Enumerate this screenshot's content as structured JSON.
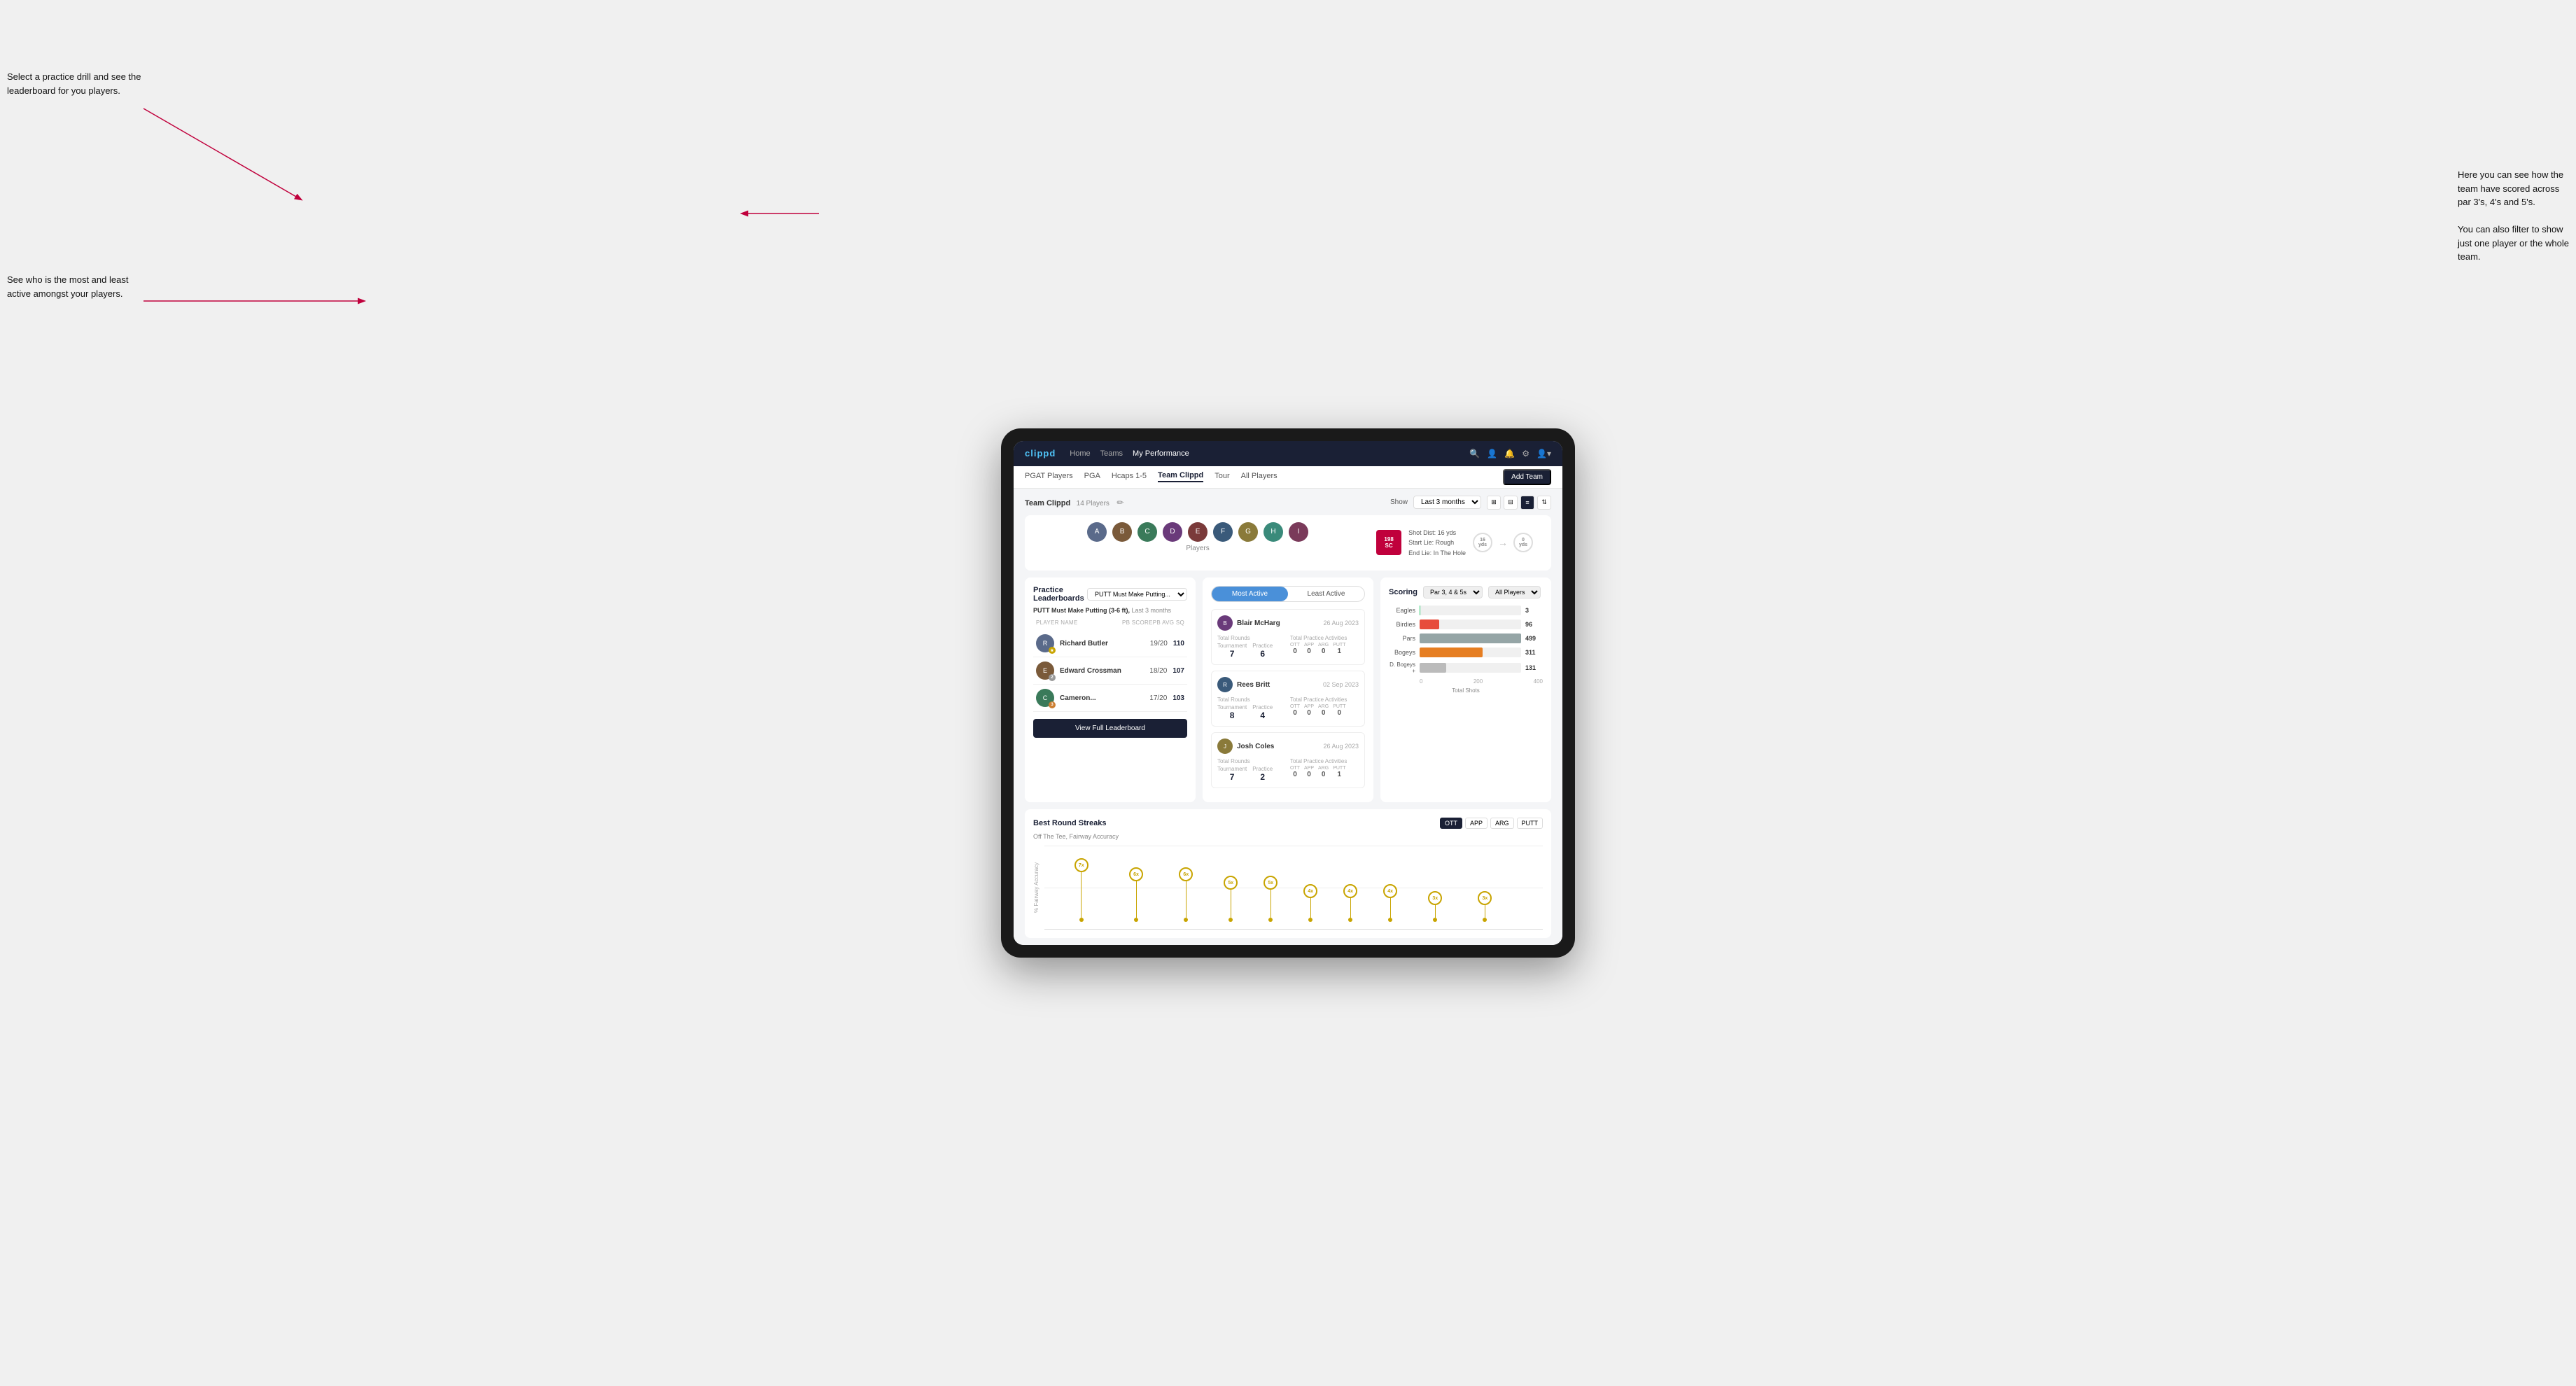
{
  "app": {
    "logo": "clippd",
    "nav": {
      "links": [
        "Home",
        "Teams",
        "My Performance"
      ],
      "icons": [
        "search",
        "person",
        "bell",
        "settings",
        "avatar"
      ]
    },
    "subnav": {
      "links": [
        "PGAT Players",
        "PGA",
        "Hcaps 1-5",
        "Team Clippd",
        "Tour",
        "All Players"
      ],
      "active": "Team Clippd",
      "add_team_label": "Add Team"
    }
  },
  "team": {
    "title": "Team Clippd",
    "player_count": "14 Players",
    "show_label": "Show",
    "show_value": "Last 3 months",
    "view_options": [
      "grid-small",
      "grid-large",
      "list-detail",
      "filter"
    ]
  },
  "players": {
    "label": "Players",
    "count": 9
  },
  "shot_panel": {
    "badge_number": "198",
    "badge_unit": "SC",
    "info_lines": [
      "Shot Dist: 16 yds",
      "Start Lie: Rough",
      "End Lie: In The Hole"
    ],
    "circle_left": {
      "value": "16",
      "unit": "yds"
    },
    "circle_right": {
      "value": "0",
      "unit": "yds"
    }
  },
  "leaderboard": {
    "title": "Practice Leaderboards",
    "drill_label": "PUTT Must Make Putting...",
    "subtitle": "PUTT Must Make Putting (3-6 ft),",
    "period": "Last 3 months",
    "col_player": "PLAYER NAME",
    "col_score": "PB SCORE",
    "col_avg": "PB AVG SQ",
    "players": [
      {
        "name": "Richard Butler",
        "score": "19/20",
        "avg": "110",
        "badge": "gold",
        "badge_num": "1",
        "avatar_color": "#5a6a8a"
      },
      {
        "name": "Edward Crossman",
        "score": "18/20",
        "avg": "107",
        "badge": "silver",
        "badge_num": "2",
        "avatar_color": "#7a5a3a"
      },
      {
        "name": "Cameron...",
        "score": "17/20",
        "avg": "103",
        "badge": "bronze",
        "badge_num": "3",
        "avatar_color": "#3a7a5a"
      }
    ],
    "view_full_label": "View Full Leaderboard"
  },
  "most_active": {
    "toggle_most": "Most Active",
    "toggle_least": "Least Active",
    "players": [
      {
        "name": "Blair McHarg",
        "date": "26 Aug 2023",
        "total_rounds_label": "Total Rounds",
        "tournament_label": "Tournament",
        "tournament_val": "7",
        "practice_label": "Practice",
        "practice_val": "6",
        "total_practice_label": "Total Practice Activities",
        "ott": "0",
        "app": "0",
        "arg": "0",
        "putt": "1",
        "avatar_color": "#6a3a7a"
      },
      {
        "name": "Rees Britt",
        "date": "02 Sep 2023",
        "total_rounds_label": "Total Rounds",
        "tournament_label": "Tournament",
        "tournament_val": "8",
        "practice_label": "Practice",
        "practice_val": "4",
        "total_practice_label": "Total Practice Activities",
        "ott": "0",
        "app": "0",
        "arg": "0",
        "putt": "0",
        "avatar_color": "#3a5a7a"
      },
      {
        "name": "Josh Coles",
        "date": "26 Aug 2023",
        "total_rounds_label": "Total Rounds",
        "tournament_label": "Tournament",
        "tournament_val": "7",
        "practice_label": "Practice",
        "practice_val": "2",
        "total_practice_label": "Total Practice Activities",
        "ott": "0",
        "app": "0",
        "arg": "0",
        "putt": "1",
        "avatar_color": "#8a7a3a"
      }
    ]
  },
  "scoring": {
    "title": "Scoring",
    "filter1": "Par 3, 4 & 5s",
    "filter2": "All Players",
    "bars": [
      {
        "label": "Eagles",
        "value": 3,
        "max": 500,
        "color": "#2ecc71",
        "class": "bar-eagles"
      },
      {
        "label": "Birdies",
        "value": 96,
        "max": 500,
        "color": "#e74c3c",
        "class": "bar-birdies"
      },
      {
        "label": "Pars",
        "value": 499,
        "max": 500,
        "color": "#95a5a6",
        "class": "bar-pars"
      },
      {
        "label": "Bogeys",
        "value": 311,
        "max": 500,
        "color": "#e67e22",
        "class": "bar-bogeys"
      },
      {
        "label": "D. Bogeys +",
        "value": 131,
        "max": 500,
        "color": "#bbb",
        "class": "bar-double"
      }
    ],
    "x_axis_labels": [
      "0",
      "200",
      "400"
    ],
    "x_axis_title": "Total Shots"
  },
  "streaks": {
    "title": "Best Round Streaks",
    "subtitle": "Off The Tee, Fairway Accuracy",
    "buttons": [
      "OTT",
      "APP",
      "ARG",
      "PUTT"
    ],
    "active_button": "OTT",
    "pins": [
      {
        "label": "7x",
        "left_pct": 6,
        "height": 75
      },
      {
        "label": "6x",
        "left_pct": 16,
        "height": 62
      },
      {
        "label": "6x",
        "left_pct": 26,
        "height": 62
      },
      {
        "label": "5x",
        "left_pct": 36,
        "height": 50
      },
      {
        "label": "5x",
        "left_pct": 44,
        "height": 50
      },
      {
        "label": "4x",
        "left_pct": 53,
        "height": 38
      },
      {
        "label": "4x",
        "left_pct": 61,
        "height": 38
      },
      {
        "label": "4x",
        "left_pct": 69,
        "height": 38
      },
      {
        "label": "3x",
        "left_pct": 78,
        "height": 26
      },
      {
        "label": "3x",
        "left_pct": 87,
        "height": 26
      }
    ]
  },
  "annotations": {
    "top_left": "Select a practice drill and see the leaderboard for you players.",
    "bottom_left": "See who is the most and least active amongst your players.",
    "top_right_line1": "Here you can see how the",
    "top_right_line2": "team have scored across",
    "top_right_line3": "par 3's, 4's and 5's.",
    "top_right_line4": "",
    "top_right_line5": "You can also filter to show",
    "top_right_line6": "just one player or the whole",
    "top_right_line7": "team."
  }
}
